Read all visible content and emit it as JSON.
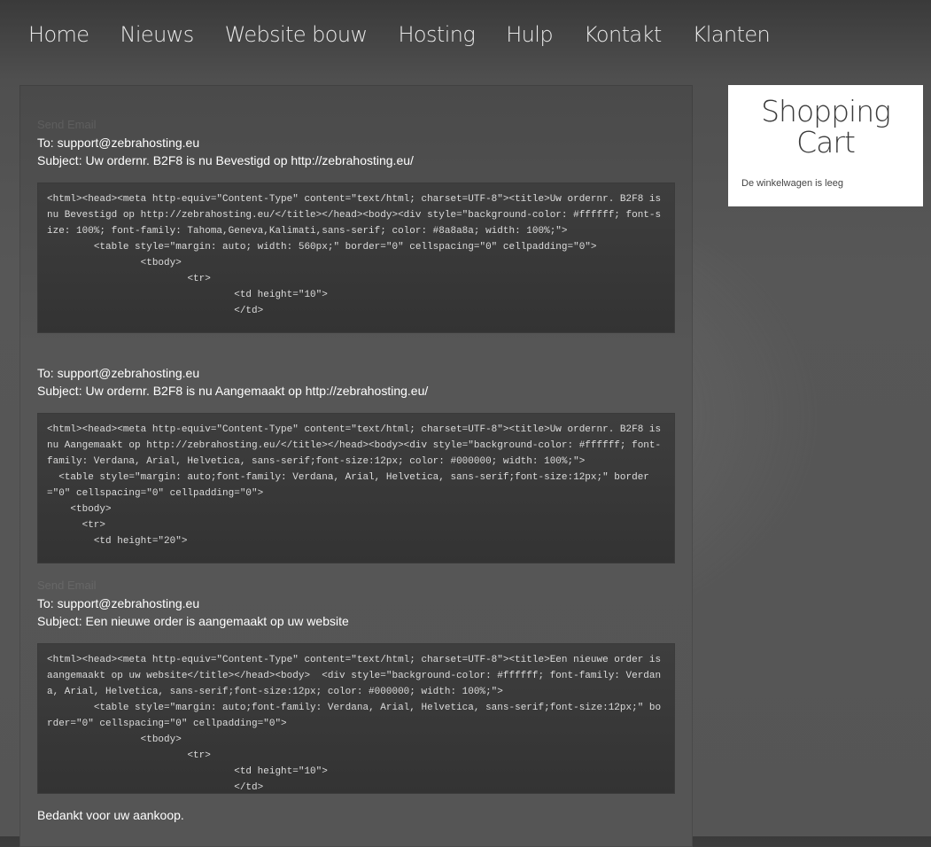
{
  "nav": {
    "items": [
      {
        "label": "Home"
      },
      {
        "label": "Nieuws"
      },
      {
        "label": "Website bouw"
      },
      {
        "label": "Hosting"
      },
      {
        "label": "Hulp"
      },
      {
        "label": "Kontakt"
      },
      {
        "label": "Klanten"
      }
    ]
  },
  "emails": [
    {
      "ghost_label": "Send Email",
      "to": "To: support@zebrahosting.eu",
      "subject": "Subject: Uw ordernr. B2F8 is nu Bevestigd op http://zebrahosting.eu/",
      "code": "<html><head><meta http-equiv=\"Content-Type\" content=\"text/html; charset=UTF-8\"><title>Uw ordernr. B2F8 is nu Bevestigd op http://zebrahosting.eu/</title></head><body><div style=\"background-color: #ffffff; font-size: 100%; font-family: Tahoma,Geneva,Kalimati,sans-serif; color: #8a8a8a; width: 100%;\">\n        <table style=\"margin: auto; width: 560px;\" border=\"0\" cellspacing=\"0\" cellpadding=\"0\">\n                <tbody>\n                        <tr>\n                                <td height=\"10\">\n                                </td>"
    },
    {
      "ghost_label": "",
      "to": "To: support@zebrahosting.eu",
      "subject": "Subject: Uw ordernr. B2F8 is nu Aangemaakt op http://zebrahosting.eu/",
      "code": "<html><head><meta http-equiv=\"Content-Type\" content=\"text/html; charset=UTF-8\"><title>Uw ordernr. B2F8 is nu Aangemaakt op http://zebrahosting.eu/</title></head><body><div style=\"background-color: #ffffff; font-family: Verdana, Arial, Helvetica, sans-serif;font-size:12px; color: #000000; width: 100%;\">\n  <table style=\"margin: auto;font-family: Verdana, Arial, Helvetica, sans-serif;font-size:12px;\" border=\"0\" cellspacing=\"0\" cellpadding=\"0\">\n    <tbody>\n      <tr>\n        <td height=\"20\">"
    },
    {
      "ghost_label": "Send Email",
      "to": "To: support@zebrahosting.eu",
      "subject": "Subject: Een nieuwe order is aangemaakt op uw website",
      "code": "<html><head><meta http-equiv=\"Content-Type\" content=\"text/html; charset=UTF-8\"><title>Een nieuwe order is aangemaakt op uw website</title></head><body>  <div style=\"background-color: #ffffff; font-family: Verdana, Arial, Helvetica, sans-serif;font-size:12px; color: #000000; width: 100%;\">\n        <table style=\"margin: auto;font-family: Verdana, Arial, Helvetica, sans-serif;font-size:12px;\" border=\"0\" cellspacing=\"0\" cellpadding=\"0\">\n                <tbody>\n                        <tr>\n                                <td height=\"10\">\n                                </td>"
    }
  ],
  "thanks": "Bedankt voor uw aankoop.",
  "cart": {
    "title": "Shopping Cart",
    "empty_message": "De winkelwagen is leeg"
  }
}
